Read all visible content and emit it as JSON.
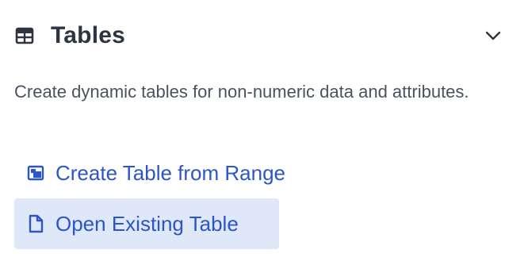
{
  "section": {
    "title": "Tables",
    "description": "Create dynamic tables for non-numeric data and attributes.",
    "icon": "table-icon",
    "expanded_indicator": "chevron-down-icon"
  },
  "actions": [
    {
      "label": "Create Table from Range",
      "icon": "range-table-icon",
      "selected": false
    },
    {
      "label": "Open Existing Table",
      "icon": "file-icon",
      "selected": true
    }
  ],
  "colors": {
    "title": "#2d3542",
    "text": "#4a5260",
    "link": "#2b55c9",
    "selected_bg": "#dfe8f8"
  }
}
